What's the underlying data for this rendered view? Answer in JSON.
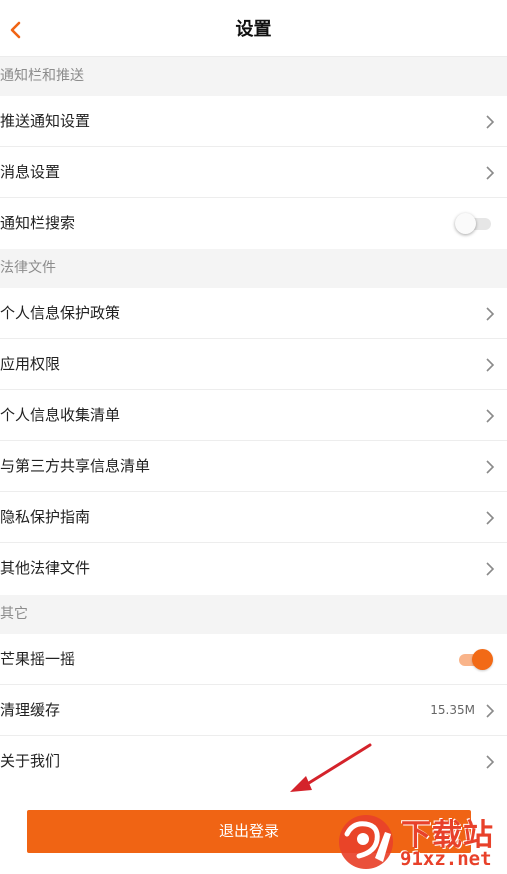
{
  "header": {
    "title": "设置",
    "back_icon": "chevron-left-icon"
  },
  "colors": {
    "accent": "#f06414",
    "section_bg": "#f4f4f4",
    "arrow": "#d4232b",
    "watermark": "#e8412a"
  },
  "sections": [
    {
      "title": "通知栏和推送",
      "items": [
        {
          "label": "推送通知设置",
          "type": "link"
        },
        {
          "label": "消息设置",
          "type": "link"
        },
        {
          "label": "通知栏搜索",
          "type": "toggle",
          "on": false
        }
      ]
    },
    {
      "title": "法律文件",
      "items": [
        {
          "label": "个人信息保护政策",
          "type": "link"
        },
        {
          "label": "应用权限",
          "type": "link"
        },
        {
          "label": "个人信息收集清单",
          "type": "link"
        },
        {
          "label": "与第三方共享信息清单",
          "type": "link"
        },
        {
          "label": "隐私保护指南",
          "type": "link"
        },
        {
          "label": "其他法律文件",
          "type": "link"
        }
      ]
    },
    {
      "title": "其它",
      "items": [
        {
          "label": "芒果摇一摇",
          "type": "toggle",
          "on": true
        },
        {
          "label": "清理缓存",
          "type": "link",
          "value": "15.35M"
        },
        {
          "label": "关于我们",
          "type": "link"
        }
      ]
    }
  ],
  "logout_label": "退出登录",
  "watermark": {
    "title": "下载站",
    "url": "91xz.net"
  }
}
